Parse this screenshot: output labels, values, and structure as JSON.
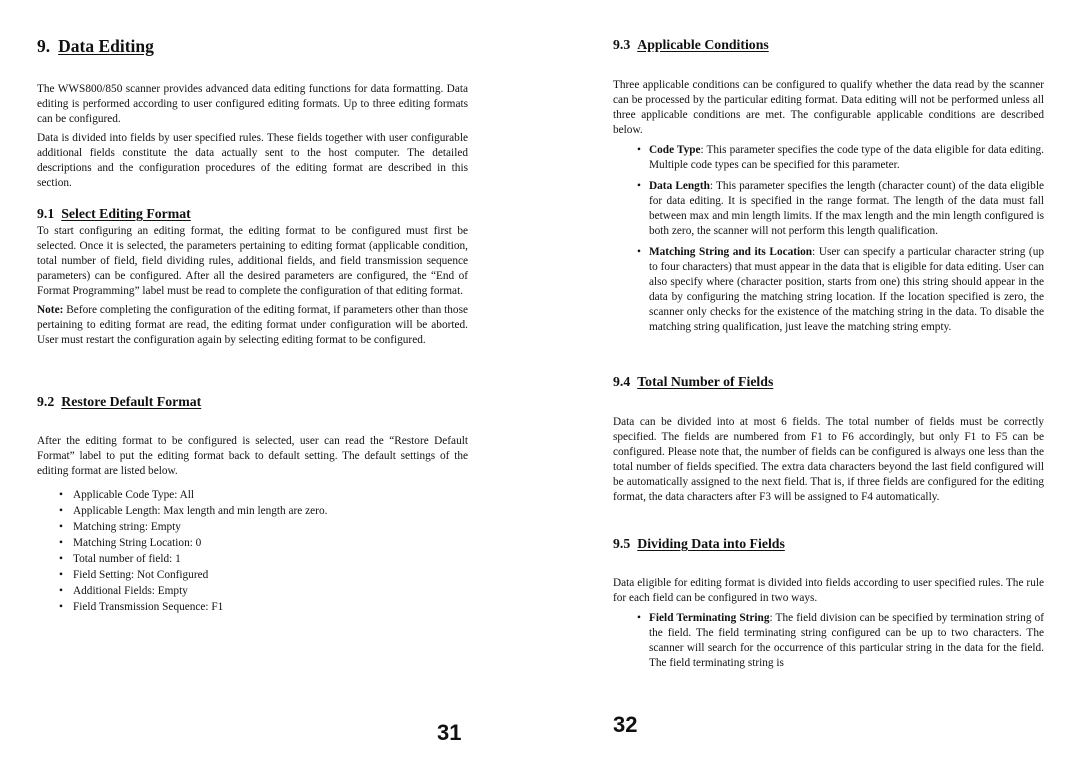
{
  "left_page": {
    "chapter": {
      "number": "9.",
      "title": "Data Editing",
      "paragraphs": [
        "The WWS800/850 scanner provides advanced data editing functions for data formatting. Data editing is performed according to user configured editing formats. Up to three editing formats can be configured.",
        "Data is divided into fields by user specified rules. These fields together with user configurable additional fields constitute the data actually sent to the host computer. The detailed descriptions and the configuration procedures of the editing format are described in this section."
      ]
    },
    "section_9_1": {
      "number": "9.1",
      "title": "Select Editing Format",
      "paragraph": "To start configuring an editing format, the editing format to be configured must first be selected. Once it is selected, the parameters pertaining to editing format (applicable condition, total number of field, field dividing rules, additional fields, and field transmission sequence parameters) can be configured. After all the desired parameters are configured, the “End of Format Programming” label must be read to complete the configuration of that editing format.",
      "note_label": "Note:",
      "note_text": " Before completing the configuration of the editing format, if parameters other than those pertaining to editing format are read, the editing format under configuration will be aborted. User must restart the configuration again by selecting editing format to be configured."
    },
    "section_9_2": {
      "number": "9.2",
      "title": "Restore Default Format",
      "paragraph": "After the editing format to be configured is selected, user can read the “Restore Default Format” label to put the editing format back to default setting. The default settings of the editing format are listed below.",
      "defaults": [
        "Applicable Code Type: All",
        "Applicable Length: Max length and min length are zero.",
        "Matching string: Empty",
        "Matching String Location: 0",
        "Total number of field: 1",
        "Field Setting: Not Configured",
        "Additional Fields: Empty",
        "Field Transmission Sequence: F1"
      ]
    },
    "page_number": "31"
  },
  "right_page": {
    "section_9_3": {
      "number": "9.3",
      "title": "Applicable Conditions",
      "paragraph": "Three applicable conditions can be configured to qualify whether the data read by the scanner can be processed by the particular editing format. Data editing will not be performed unless all three applicable conditions are met. The configurable applicable conditions are described below.",
      "items": [
        {
          "term": "Code Type",
          "text": ": This parameter specifies the code type of the data eligible for data editing. Multiple code types can be specified for this parameter."
        },
        {
          "term": "Data Length",
          "text": ": This parameter specifies the length (character count) of the data eligible for data editing. It is specified in the range format. The length of the data must fall between max and min length limits. If the max length and the min length configured is both zero, the scanner will not perform this length qualification."
        },
        {
          "term": "Matching String and its Location",
          "text": ": User can specify a particular character string (up to four characters) that must appear in the data that is eligible for data editing. User can also specify where (character position, starts from one) this string should appear in the data by configuring the matching string location. If the location specified is zero, the scanner only checks for the existence of the matching string in the data. To disable the matching string qualification, just leave the matching string empty."
        }
      ]
    },
    "section_9_4": {
      "number": "9.4",
      "title": "Total Number of Fields",
      "paragraph": "Data can be divided into at most 6 fields. The total number of fields must be correctly specified. The fields are numbered from F1 to F6 accordingly, but only F1 to F5 can be configured. Please note that, the number of fields can be configured is always one less than the total number of fields specified. The extra data characters beyond the last field configured will be automatically assigned to the next field. That is, if three fields are configured for the editing format, the data characters after F3 will be assigned to F4 automatically."
    },
    "section_9_5": {
      "number": "9.5",
      "title": "Dividing Data into Fields",
      "paragraph": "Data eligible for editing format is divided into fields according to user specified rules. The rule for each field can be configured in two ways.",
      "items": [
        {
          "term": "Field Terminating String",
          "text": ": The field division can be specified by termination string of the field. The field terminating string configured can be up to two characters. The scanner will search for the occurrence of this particular string in the data for the field. The field terminating string is"
        }
      ]
    },
    "page_number": "32"
  }
}
